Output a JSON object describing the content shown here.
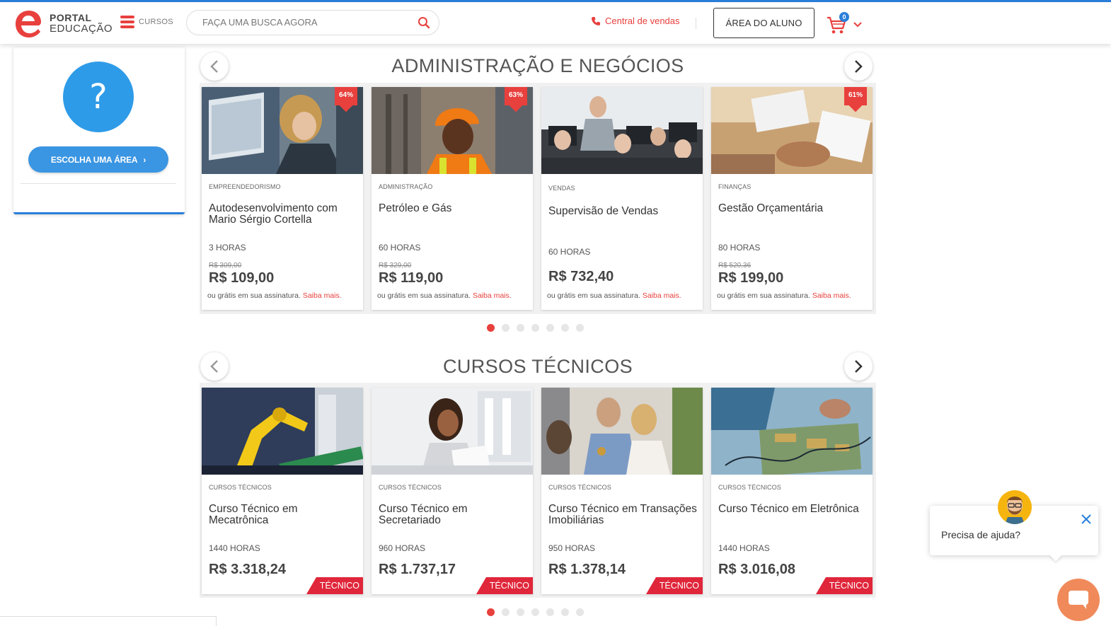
{
  "header": {
    "logo_line1": "PORTAL",
    "logo_line2": "EDUCAÇÃO",
    "menu_label": "CURSOS",
    "search_placeholder": "FAÇA UMA BUSCA AGORA",
    "sales_label": "Central de vendas",
    "student_area_label": "ÁREA DO ALUNO",
    "cart_count": "0",
    "brand_color": "#e8403d",
    "accent_color": "#2a7fd9"
  },
  "sidebar": {
    "question_mark": "?",
    "choose_area_label": "ESCOLHA UMA ÁREA",
    "chevron": "›"
  },
  "sections": [
    {
      "title": "ADMINISTRAÇÃO E NEGÓCIOS",
      "cards": [
        {
          "category": "EMPREENDEDORISMO",
          "title": "Autodesenvolvimento com Mario Sérgio Cortella",
          "hours": "3 HORAS",
          "old_price": "R$ 309,00",
          "price": "R$ 109,00",
          "discount": "64%",
          "sub_text": "ou grátis em sua assinatura.",
          "sub_link": "Saiba mais."
        },
        {
          "category": "ADMINISTRAÇÃO",
          "title": "Petróleo e Gás",
          "hours": "60 HORAS",
          "old_price": "R$ 329,00",
          "price": "R$ 119,00",
          "discount": "63%",
          "sub_text": "ou grátis em sua assinatura.",
          "sub_link": "Saiba mais."
        },
        {
          "category": "VENDAS",
          "title": "Supervisão de Vendas",
          "hours": "60 HORAS",
          "old_price": "",
          "price": "R$ 732,40",
          "discount": "",
          "sub_text": "ou grátis em sua assinatura.",
          "sub_link": "Saiba mais."
        },
        {
          "category": "FINANÇAS",
          "title": "Gestão Orçamentária",
          "hours": "80 HORAS",
          "old_price": "R$ 520,36",
          "price": "R$ 199,00",
          "discount": "61%",
          "sub_text": "ou grátis em sua assinatura.",
          "sub_link": "Saiba mais."
        }
      ]
    },
    {
      "title": "CURSOS TÉCNICOS",
      "cards": [
        {
          "category": "CURSOS TÉCNICOS",
          "title": "Curso Técnico em Mecatrônica",
          "hours": "1440 HORAS",
          "price": "R$ 3.318,24",
          "tag": "TÉCNICO"
        },
        {
          "category": "CURSOS TÉCNICOS",
          "title": "Curso Técnico em Secretariado",
          "hours": "960 HORAS",
          "price": "R$ 1.737,17",
          "tag": "TÉCNICO"
        },
        {
          "category": "CURSOS TÉCNICOS",
          "title": "Curso Técnico em Transações Imobiliárias",
          "hours": "950 HORAS",
          "price": "R$ 1.378,14",
          "tag": "TÉCNICO"
        },
        {
          "category": "CURSOS TÉCNICOS",
          "title": "Curso Técnico em Eletrônica",
          "hours": "1440 HORAS",
          "price": "R$ 3.016,08",
          "tag": "TÉCNICO"
        }
      ]
    }
  ],
  "help_widget": {
    "text": "Precisa de ajuda?"
  }
}
